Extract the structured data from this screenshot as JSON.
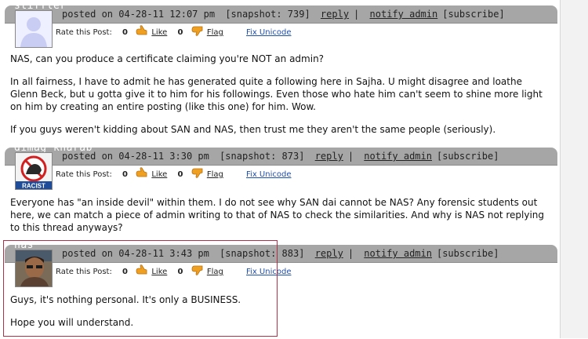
{
  "posts": [
    {
      "username": "stiffler",
      "posted": "posted on 04-28-11 12:07 pm",
      "snapshot": "[snapshot: 739]",
      "reply": "reply",
      "notify": "notify admin",
      "subscribe": "[subscribe]",
      "rate_label": "Rate this Post:",
      "like_count": "0",
      "like_label": "Like",
      "flag_count": "0",
      "flag_label": "Flag",
      "fix_unicode": "Fix Unicode",
      "paragraphs": [
        "NAS, can you produce a certificate claiming you're NOT an admin?",
        "In all fairness, I have to admit he has generated quite a following here in Sajha. U might disagree and loathe Glenn Beck, but u gotta give it to him for his followings. Even those who hate him can't seem to shine more light on him by creating an entire posting (like this one) for him. Wow.",
        "If you guys weren't kidding about SAN and NAS, then trust me they aren't the same people (seriously)."
      ]
    },
    {
      "username": "dimag kharab",
      "posted": "posted on 04-28-11 3:30 pm",
      "snapshot": "[snapshot: 873]",
      "reply": "reply",
      "notify": "notify admin",
      "subscribe": "[subscribe]",
      "rate_label": "Rate this Post:",
      "like_count": "0",
      "like_label": "Like",
      "flag_count": "0",
      "flag_label": "Flag",
      "fix_unicode": "Fix Unicode",
      "avatar_text": "RACIST",
      "paragraphs": [
        "Everyone has \"an inside devil\" within them. I do not see why SAN dai cannot be NAS? Any forensic students out here, we can match a piece of admin writing to that of NAS to check the similarities. And why is NAS not replying to this thread anyways?"
      ]
    },
    {
      "username": "nas",
      "posted": "posted on 04-28-11 3:43 pm",
      "snapshot": "[snapshot: 883]",
      "reply": "reply",
      "notify": "notify admin",
      "subscribe": "[subscribe]",
      "rate_label": "Rate this Post:",
      "like_count": "0",
      "like_label": "Like",
      "flag_count": "0",
      "flag_label": "Flag",
      "fix_unicode": "Fix Unicode",
      "paragraphs": [
        "Guys, it's nothing personal. It's only a BUSINESS.",
        "Hope you will understand."
      ]
    }
  ],
  "colors": {
    "header_bar": "#a6a6a6",
    "highlight_border": "#b0304a",
    "fix_link": "#1f4fb0"
  },
  "icons": [
    "like-hand-icon",
    "flag-hand-icon"
  ]
}
